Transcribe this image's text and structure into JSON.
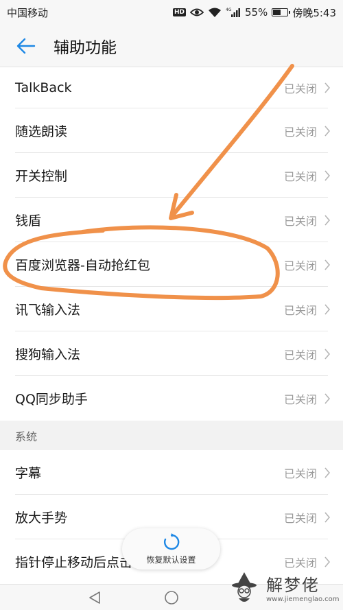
{
  "status_bar": {
    "carrier": "中国移动",
    "hd": "HD",
    "network": "4G",
    "battery_pct_text": "55%",
    "battery_level": 0.55,
    "time": "傍晚5:43"
  },
  "header": {
    "title": "辅助功能",
    "back_icon": "arrow-left-icon"
  },
  "services": [
    {
      "label": "TalkBack",
      "value": "已关闭"
    },
    {
      "label": "随选朗读",
      "value": "已关闭"
    },
    {
      "label": "开关控制",
      "value": "已关闭"
    },
    {
      "label": "钱盾",
      "value": "已关闭"
    },
    {
      "label": "百度浏览器-自动抢红包",
      "value": "已关闭"
    },
    {
      "label": "讯飞输入法",
      "value": "已关闭"
    },
    {
      "label": "搜狗输入法",
      "value": "已关闭"
    },
    {
      "label": "QQ同步助手",
      "value": "已关闭"
    }
  ],
  "system_section": {
    "header": "系统",
    "items": [
      {
        "label": "字幕",
        "value": "已关闭"
      },
      {
        "label": "放大手势",
        "value": "已关闭"
      },
      {
        "label": "指针停止移动后点击",
        "value": "已关闭"
      }
    ]
  },
  "toast": {
    "label": "恢复默认设置",
    "icon": "refresh-icon"
  },
  "nav_bar": {
    "back_icon": "triangle-back-icon",
    "home_icon": "circle-home-icon"
  },
  "watermark": {
    "title": "解梦佬",
    "url": "www.jiemenglao.com"
  },
  "colors": {
    "accent": "#1e88e5",
    "annotation": "#f0914a",
    "value_text": "#9a9a9a"
  }
}
